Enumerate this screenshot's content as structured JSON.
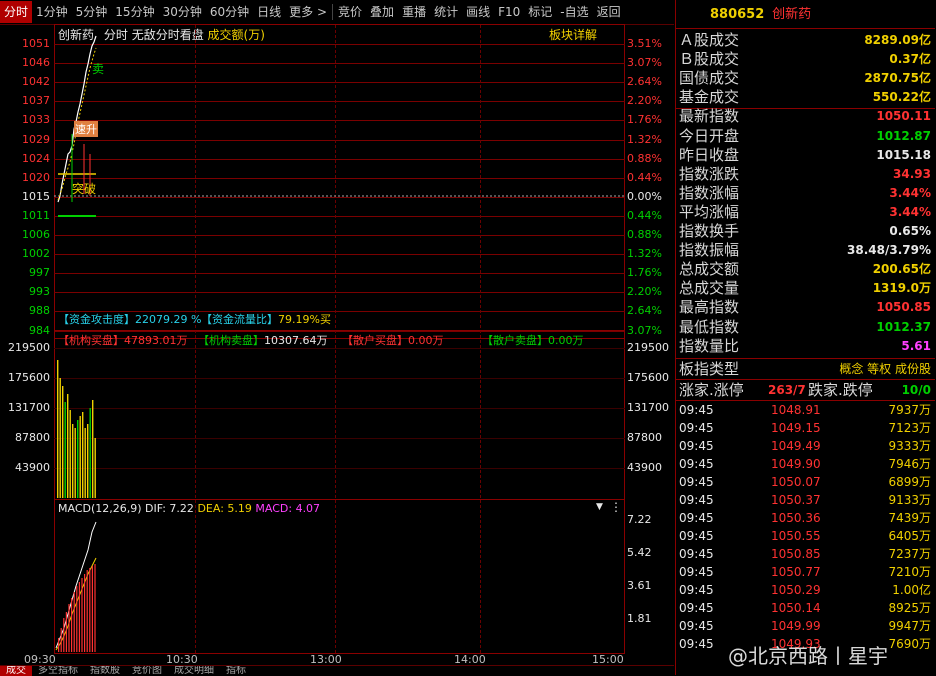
{
  "toolbar": {
    "items": [
      "分时",
      "1分钟",
      "5分钟",
      "15分钟",
      "30分钟",
      "60分钟",
      "日线",
      "更多 >",
      "竞价",
      "叠加",
      "重播",
      "统计",
      "画线",
      "F10",
      "标记",
      "-自选",
      "返回"
    ]
  },
  "main_chart": {
    "stock_name": "创新药",
    "mode": "分时",
    "mode_desc": "无敌分时看盘",
    "volume_unit": "成交额(万)",
    "sector_detail": "板块详解",
    "price_ticks": [
      "1051",
      "1046",
      "1042",
      "1037",
      "1033",
      "1029",
      "1024",
      "1020",
      "1015",
      "1011",
      "1006",
      "1002",
      "997",
      "993",
      "988",
      "984"
    ],
    "pct_ticks": [
      "3.51%",
      "3.07%",
      "2.64%",
      "2.20%",
      "1.76%",
      "1.32%",
      "0.88%",
      "0.44%",
      "0.00%",
      "0.44%",
      "0.88%",
      "1.32%",
      "1.76%",
      "2.20%",
      "2.64%",
      "3.07%"
    ],
    "signals": {
      "sell": "卖",
      "surge": "速升",
      "breakout": "突破"
    }
  },
  "capital_info": {
    "attack_label": "【资金攻击度】",
    "attack_value": "22079.29 %",
    "flow_ratio_label": "【资金流量比】",
    "flow_ratio_value": "79.19%买",
    "inst_buy_label": "【机构买盘】",
    "inst_buy_value": "47893.01万",
    "inst_sell_label": "【机构卖盘】",
    "inst_sell_value": "10307.64万",
    "retail_buy_label": "【散户买盘】",
    "retail_buy_value": "0.00万",
    "retail_sell_label": "【散户卖盘】",
    "retail_sell_value": "0.00万"
  },
  "volume_chart": {
    "ticks": [
      "219500",
      "175600",
      "131700",
      "87800",
      "43900"
    ]
  },
  "macd": {
    "label": "MACD(12,26,9)",
    "dif_label": "DIF: 7.22",
    "dea_label": "DEA: 5.19",
    "macd_label": "MACD: 4.07",
    "ticks": [
      "7.22",
      "5.42",
      "3.61",
      "1.81"
    ]
  },
  "time_axis": [
    "09:30",
    "10:30",
    "13:00",
    "14:00",
    "15:00"
  ],
  "bottom_tabs": [
    "成交",
    "多空指标",
    "指数股",
    "竞价图",
    "成交明细",
    "指标"
  ],
  "right_panel": {
    "code": "880652",
    "name": "创新药",
    "stats": [
      {
        "label": "Ａ股成交",
        "value": "8289.09亿",
        "color": "#f0d000"
      },
      {
        "label": "Ｂ股成交",
        "value": "0.37亿",
        "color": "#f0d000"
      },
      {
        "label": "国债成交",
        "value": "2870.75亿",
        "color": "#f0d000"
      },
      {
        "label": "基金成交",
        "value": "550.22亿",
        "color": "#f0d000"
      },
      {
        "label": "最新指数",
        "value": "1050.11",
        "color": "#ff3232"
      },
      {
        "label": "今日开盘",
        "value": "1012.87",
        "color": "#00d000"
      },
      {
        "label": "昨日收盘",
        "value": "1015.18",
        "color": "#e8e8e8"
      },
      {
        "label": "指数涨跌",
        "value": "34.93",
        "color": "#ff3232"
      },
      {
        "label": "指数涨幅",
        "value": "3.44%",
        "color": "#ff3232"
      },
      {
        "label": "平均涨幅",
        "value": "3.44%",
        "color": "#ff3232"
      },
      {
        "label": "指数换手",
        "value": "0.65%",
        "color": "#e8e8e8"
      },
      {
        "label": "指数振幅",
        "value": "38.48/3.79%",
        "color": "#e8e8e8"
      },
      {
        "label": "总成交额",
        "value": "200.65亿",
        "color": "#f0d000"
      },
      {
        "label": "总成交量",
        "value": "1319.0万",
        "color": "#f0d000"
      },
      {
        "label": "最高指数",
        "value": "1050.85",
        "color": "#ff3232"
      },
      {
        "label": "最低指数",
        "value": "1012.37",
        "color": "#00d000"
      },
      {
        "label": "指数量比",
        "value": "5.61",
        "color": "#ff40ff"
      }
    ],
    "sector_type_label": "板指类型",
    "sector_type_value": "概念 等权 成份股",
    "updown_label1": "涨家.涨停",
    "updown_value1": "263/7",
    "updown_label2": "跌家.跌停",
    "updown_value2": "10/0",
    "ticks": [
      {
        "time": "09:45",
        "price": "1048.91",
        "amount": "7937万"
      },
      {
        "time": "09:45",
        "price": "1049.15",
        "amount": "7123万"
      },
      {
        "time": "09:45",
        "price": "1049.49",
        "amount": "9333万"
      },
      {
        "time": "09:45",
        "price": "1049.90",
        "amount": "7946万"
      },
      {
        "time": "09:45",
        "price": "1050.07",
        "amount": "6899万"
      },
      {
        "time": "09:45",
        "price": "1050.37",
        "amount": "9133万"
      },
      {
        "time": "09:45",
        "price": "1050.36",
        "amount": "7439万"
      },
      {
        "time": "09:45",
        "price": "1050.55",
        "amount": "6405万"
      },
      {
        "time": "09:45",
        "price": "1050.85",
        "amount": "7237万"
      },
      {
        "time": "09:45",
        "price": "1050.77",
        "amount": "7210万"
      },
      {
        "time": "09:45",
        "price": "1050.29",
        "amount": "1.00亿"
      },
      {
        "time": "09:45",
        "price": "1050.14",
        "amount": "8925万"
      },
      {
        "time": "09:45",
        "price": "1049.99",
        "amount": "9947万"
      },
      {
        "time": "09:45",
        "price": "1049.93",
        "amount": "7690万"
      }
    ]
  },
  "watermark": "@北京西路丨星宇"
}
